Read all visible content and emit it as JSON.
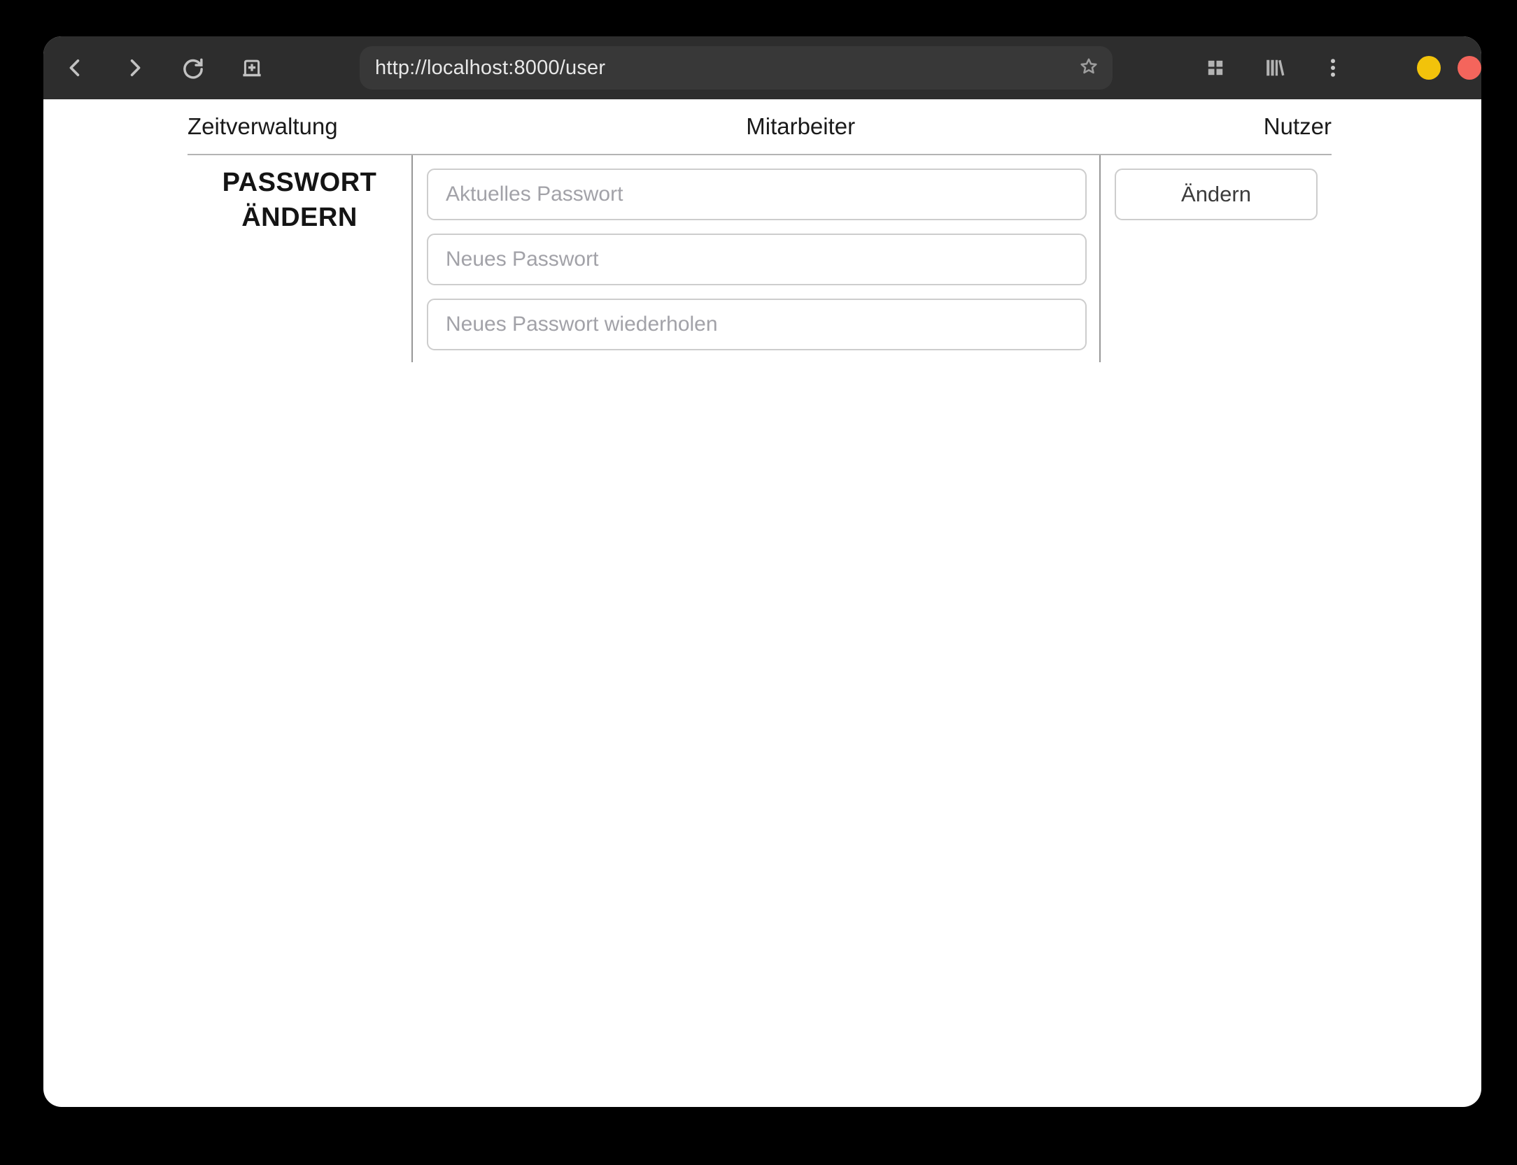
{
  "browser": {
    "url": "http://localhost:8000/user",
    "toolbar_icons": [
      "back",
      "forward",
      "reload",
      "new-tab",
      "bookmark-star",
      "tab-grid",
      "library",
      "menu-kebab"
    ],
    "window_controls": [
      "minimize",
      "close"
    ]
  },
  "nav": {
    "items": [
      "Zeitverwaltung",
      "Mitarbeiter",
      "Nutzer"
    ]
  },
  "password_form": {
    "heading_line1": "PASSWORT",
    "heading_line2": "ÄNDERN",
    "fields": [
      {
        "placeholder": "Aktuelles Passwort",
        "value": ""
      },
      {
        "placeholder": "Neues Passwort",
        "value": ""
      },
      {
        "placeholder": "Neues Passwort wiederholen",
        "value": ""
      }
    ],
    "submit_label": "Ändern"
  },
  "colors": {
    "toolbar_bg": "#2d2d2d",
    "urlbar_bg": "#383838",
    "icon_gray": "#c2c2c2",
    "minimize_yellow": "#f2c30b",
    "close_red": "#f4655c",
    "divider_gray": "#979797",
    "nav_border_gray": "#b4b4b4",
    "input_border": "#cdcdcd",
    "placeholder_gray": "#a2a2a8"
  }
}
